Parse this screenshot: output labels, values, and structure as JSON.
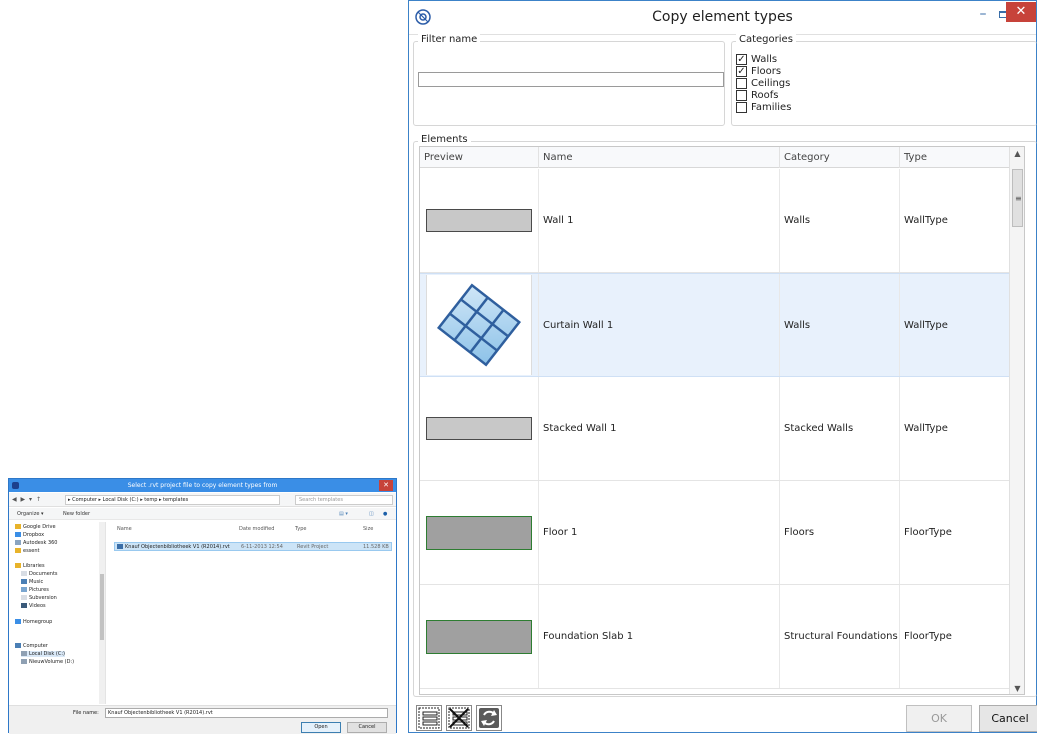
{
  "copy_window": {
    "title": "Copy element types",
    "min_glyph": "–",
    "close_glyph": "✕",
    "filter": {
      "label": "Filter name",
      "value": ""
    },
    "categories": {
      "label": "Categories",
      "items": [
        {
          "label": "Walls",
          "checked": true
        },
        {
          "label": "Floors",
          "checked": true
        },
        {
          "label": "Ceilings",
          "checked": false
        },
        {
          "label": "Roofs",
          "checked": false
        },
        {
          "label": "Families",
          "checked": false
        }
      ]
    },
    "elements": {
      "label": "Elements",
      "columns": [
        "Preview",
        "Name",
        "Category",
        "Type"
      ],
      "rows": [
        {
          "name": "Wall 1",
          "category": "Walls",
          "type": "WallType",
          "preview": "gray-swatch"
        },
        {
          "name": "Curtain Wall 1",
          "category": "Walls",
          "type": "WallType",
          "preview": "curtain-grid"
        },
        {
          "name": "Stacked Wall 1",
          "category": "Stacked Walls",
          "type": "WallType",
          "preview": "gray-swatch"
        },
        {
          "name": "Floor 1",
          "category": "Floors",
          "type": "FloorType",
          "preview": "floor-swatch"
        },
        {
          "name": "Foundation Slab 1",
          "category": "Structural Foundations",
          "type": "FloorType",
          "preview": "floor-swatch"
        }
      ],
      "selected_row": 1
    },
    "buttons": {
      "ok": "OK",
      "cancel": "Cancel"
    }
  },
  "open_dialog": {
    "title": "Select .rvt project file to copy element types from",
    "path": "▸ Computer ▸ Local Disk (C:) ▸ temp ▸ templates",
    "search_placeholder": "Search templates",
    "toolbar": {
      "organize": "Organize ▾",
      "new_folder": "New folder"
    },
    "nav_items": [
      "Google Drive",
      "Dropbox",
      "Autodesk 360",
      "essent",
      "Libraries",
      "Documents",
      "Music",
      "Pictures",
      "Subversion",
      "Videos",
      "Homegroup",
      "Computer",
      "Local Disk (C:)",
      "NieuwVolume (D:)"
    ],
    "columns": {
      "name": "Name",
      "date": "Date modified",
      "type": "Type",
      "size": "Size"
    },
    "file": {
      "name": "Knauf Objectenbibliotheek V1 (R2014).rvt",
      "date": "6-11-2013 12:54",
      "type": "Revit Project",
      "size": "11.528 KB"
    },
    "filename_label": "File name:",
    "filename_value": "Knauf Objectenbibliotheek V1 (R2014).rvt",
    "open_label": "Open",
    "cancel_label": "Cancel"
  },
  "colors": {
    "accent": "#3a8ee6",
    "close_red": "#c7433a",
    "selected_row": "#e8f1fc",
    "wall_swatch": "#c8c8c8",
    "floor_swatch": "#a0a0a0",
    "floor_border": "#2e7d32",
    "curtain_glass": "#a9d2ee",
    "curtain_frame": "#2f5f9e"
  }
}
